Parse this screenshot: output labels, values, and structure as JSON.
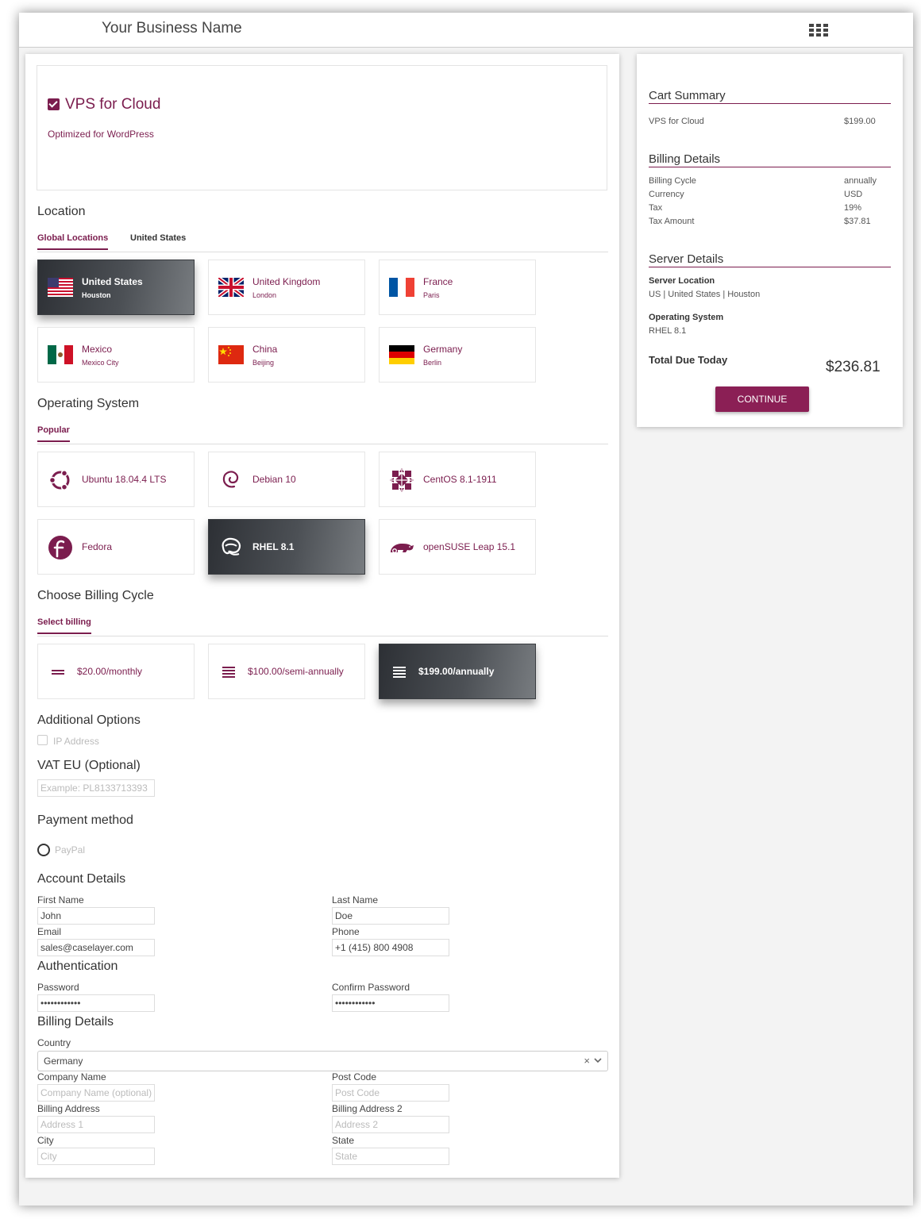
{
  "header": {
    "brand": "Your Business Name",
    "apps_icon": "grid-apps-icon"
  },
  "product": {
    "title": "VPS for Cloud",
    "subtitle": "Optimized for WordPress",
    "checked": true
  },
  "location": {
    "title": "Location",
    "tabs": [
      "Global Locations",
      "United States"
    ],
    "active_tab": 0,
    "items": [
      {
        "name": "United States",
        "city": "Houston",
        "flag": "us",
        "selected": true
      },
      {
        "name": "United Kingdom",
        "city": "London",
        "flag": "uk",
        "selected": false
      },
      {
        "name": "France",
        "city": "Paris",
        "flag": "fr",
        "selected": false
      },
      {
        "name": "Mexico",
        "city": "Mexico City",
        "flag": "mx",
        "selected": false
      },
      {
        "name": "China",
        "city": "Beijing",
        "flag": "cn",
        "selected": false
      },
      {
        "name": "Germany",
        "city": "Berlin",
        "flag": "de",
        "selected": false
      }
    ]
  },
  "os": {
    "title": "Operating System",
    "tabs": [
      "Popular"
    ],
    "items": [
      {
        "name": "Ubuntu 18.04.4 LTS",
        "icon": "ubuntu-icon",
        "selected": false
      },
      {
        "name": "Debian 10",
        "icon": "debian-icon",
        "selected": false
      },
      {
        "name": "CentOS 8.1-1911",
        "icon": "centos-icon",
        "selected": false
      },
      {
        "name": "Fedora",
        "icon": "fedora-icon",
        "selected": false
      },
      {
        "name": "RHEL 8.1",
        "icon": "rhel-icon",
        "selected": true
      },
      {
        "name": "openSUSE Leap 15.1",
        "icon": "opensuse-icon",
        "selected": false
      }
    ]
  },
  "billing_cycle": {
    "title": "Choose Billing Cycle",
    "tabs": [
      "Select billing"
    ],
    "items": [
      {
        "label": "$20.00/monthly",
        "icon": "two-lines-icon",
        "selected": false
      },
      {
        "label": "$100.00/semi-annually",
        "icon": "four-lines-icon",
        "selected": false
      },
      {
        "label": "$199.00/annually",
        "icon": "four-lines-icon",
        "selected": true
      }
    ]
  },
  "additional": {
    "title": "Additional Options",
    "ip_label": "IP Address"
  },
  "vat": {
    "title": "VAT EU (Optional)",
    "placeholder": "Example: PL8133713393"
  },
  "payment": {
    "title": "Payment method",
    "option": "PayPal"
  },
  "account": {
    "title": "Account Details",
    "first_name_label": "First Name",
    "first_name": "John",
    "last_name_label": "Last Name",
    "last_name": "Doe",
    "email_label": "Email",
    "email": "sales@caselayer.com",
    "phone_label": "Phone",
    "phone": "+1 (415) 800 4908"
  },
  "auth": {
    "title": "Authentication",
    "password_label": "Password",
    "password": "••••••••••••",
    "confirm_label": "Confirm Password",
    "confirm": "••••••••••••"
  },
  "billing_details": {
    "title": "Billing Details",
    "country_label": "Country",
    "country": "Germany",
    "clear": "×",
    "company_label": "Company Name",
    "company_ph": "Company Name (optional)",
    "postcode_label": "Post Code",
    "postcode_ph": "Post Code",
    "address_label": "Billing Address",
    "address_ph": "Address 1",
    "address2_label": "Billing Address 2",
    "address2_ph": "Address 2",
    "city_label": "City",
    "city_ph": "City",
    "state_label": "State",
    "state_ph": "State"
  },
  "summary": {
    "cart_title": "Cart Summary",
    "item_name": "VPS for Cloud",
    "item_price": "$199.00",
    "billing_title": "Billing Details",
    "rows": [
      {
        "label": "Billing Cycle",
        "value": "annually"
      },
      {
        "label": "Currency",
        "value": "USD"
      },
      {
        "label": "Tax",
        "value": "19%"
      },
      {
        "label": "Tax Amount",
        "value": "$37.81"
      }
    ],
    "server_title": "Server Details",
    "server_location_label": "Server Location",
    "server_location": "US | United States | Houston",
    "os_label": "Operating System",
    "os_value": "RHEL 8.1",
    "total_label": "Total Due Today",
    "total_value": "$236.81",
    "continue_label": "CONTINUE"
  },
  "colors": {
    "accent": "#7b1d4e",
    "button": "#8b1f55",
    "selected_dark": "#2d3035"
  }
}
